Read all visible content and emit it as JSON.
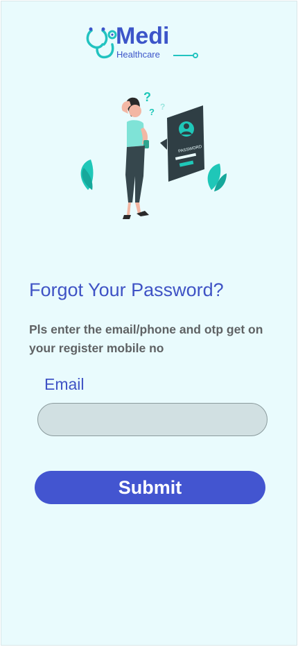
{
  "brand": {
    "name": "Medi",
    "tagline": "Healthcare",
    "logo_icon": "stethoscope-icon",
    "accent_color": "#22c3c0",
    "primary_color": "#3f53c5"
  },
  "illustration": {
    "name": "forgot-password-illustration",
    "badge_text": "PASSWORD"
  },
  "form": {
    "title": "Forgot Your Password?",
    "description": "Pls enter the email/phone and otp get on your register mobile no",
    "email_label": "Email",
    "email_value": "",
    "email_placeholder": "",
    "submit_label": "Submit"
  }
}
